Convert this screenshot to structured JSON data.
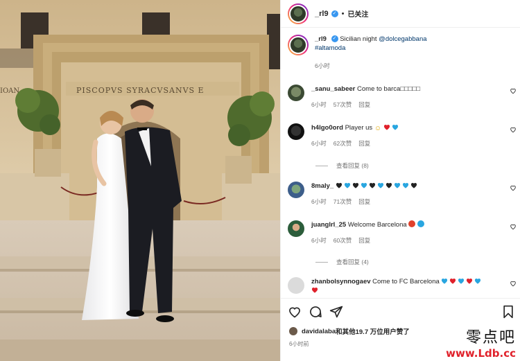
{
  "post": {
    "author": "_rl9",
    "follow_status": "已关注",
    "caption_text": "Sicilian night ",
    "caption_mention": "@dolcegabbana",
    "caption_hashtag": "#altamoda",
    "caption_time": "6小时"
  },
  "photo": {
    "inscription": "PISCOPVS SYRACVSANVS E",
    "inscription_left": "IOAN"
  },
  "comments": [
    {
      "user": "_sanu_sabeer",
      "text": "Come to barca",
      "trail": "□□□□□",
      "time": "6小时",
      "likes": "57次赞",
      "reply": "回复"
    },
    {
      "user": "h4lgo0ord",
      "text": "Player us ",
      "time": "6小时",
      "likes": "62次赞",
      "reply": "回复",
      "view_replies": "查看回复 (8)"
    },
    {
      "user": "8maly_",
      "text": "",
      "time": "6小时",
      "likes": "71次赞",
      "reply": "回复"
    },
    {
      "user": "juanglrl_25",
      "text": "Welcome Barcelona ",
      "time": "6小时",
      "likes": "60次赞",
      "reply": "回复",
      "view_replies": "查看回复 (4)"
    },
    {
      "user": "zhanbolsynnogaev",
      "text": "Come to FC Barcelona "
    }
  ],
  "likes": {
    "liker": "davidalaba",
    "rest": "和其他19.7 万位用户赞了"
  },
  "footer_time": "6小时前",
  "watermark": {
    "cn": "零点吧",
    "url": "www.Ldb.cc"
  },
  "icons": {
    "verified": "✓",
    "heart": "heart-icon",
    "comment": "comment-icon",
    "share": "share-icon",
    "save": "bookmark-icon"
  },
  "colors": {
    "verified": "#3897f0",
    "link": "#00376b",
    "watermark_url": "#e0212b"
  }
}
